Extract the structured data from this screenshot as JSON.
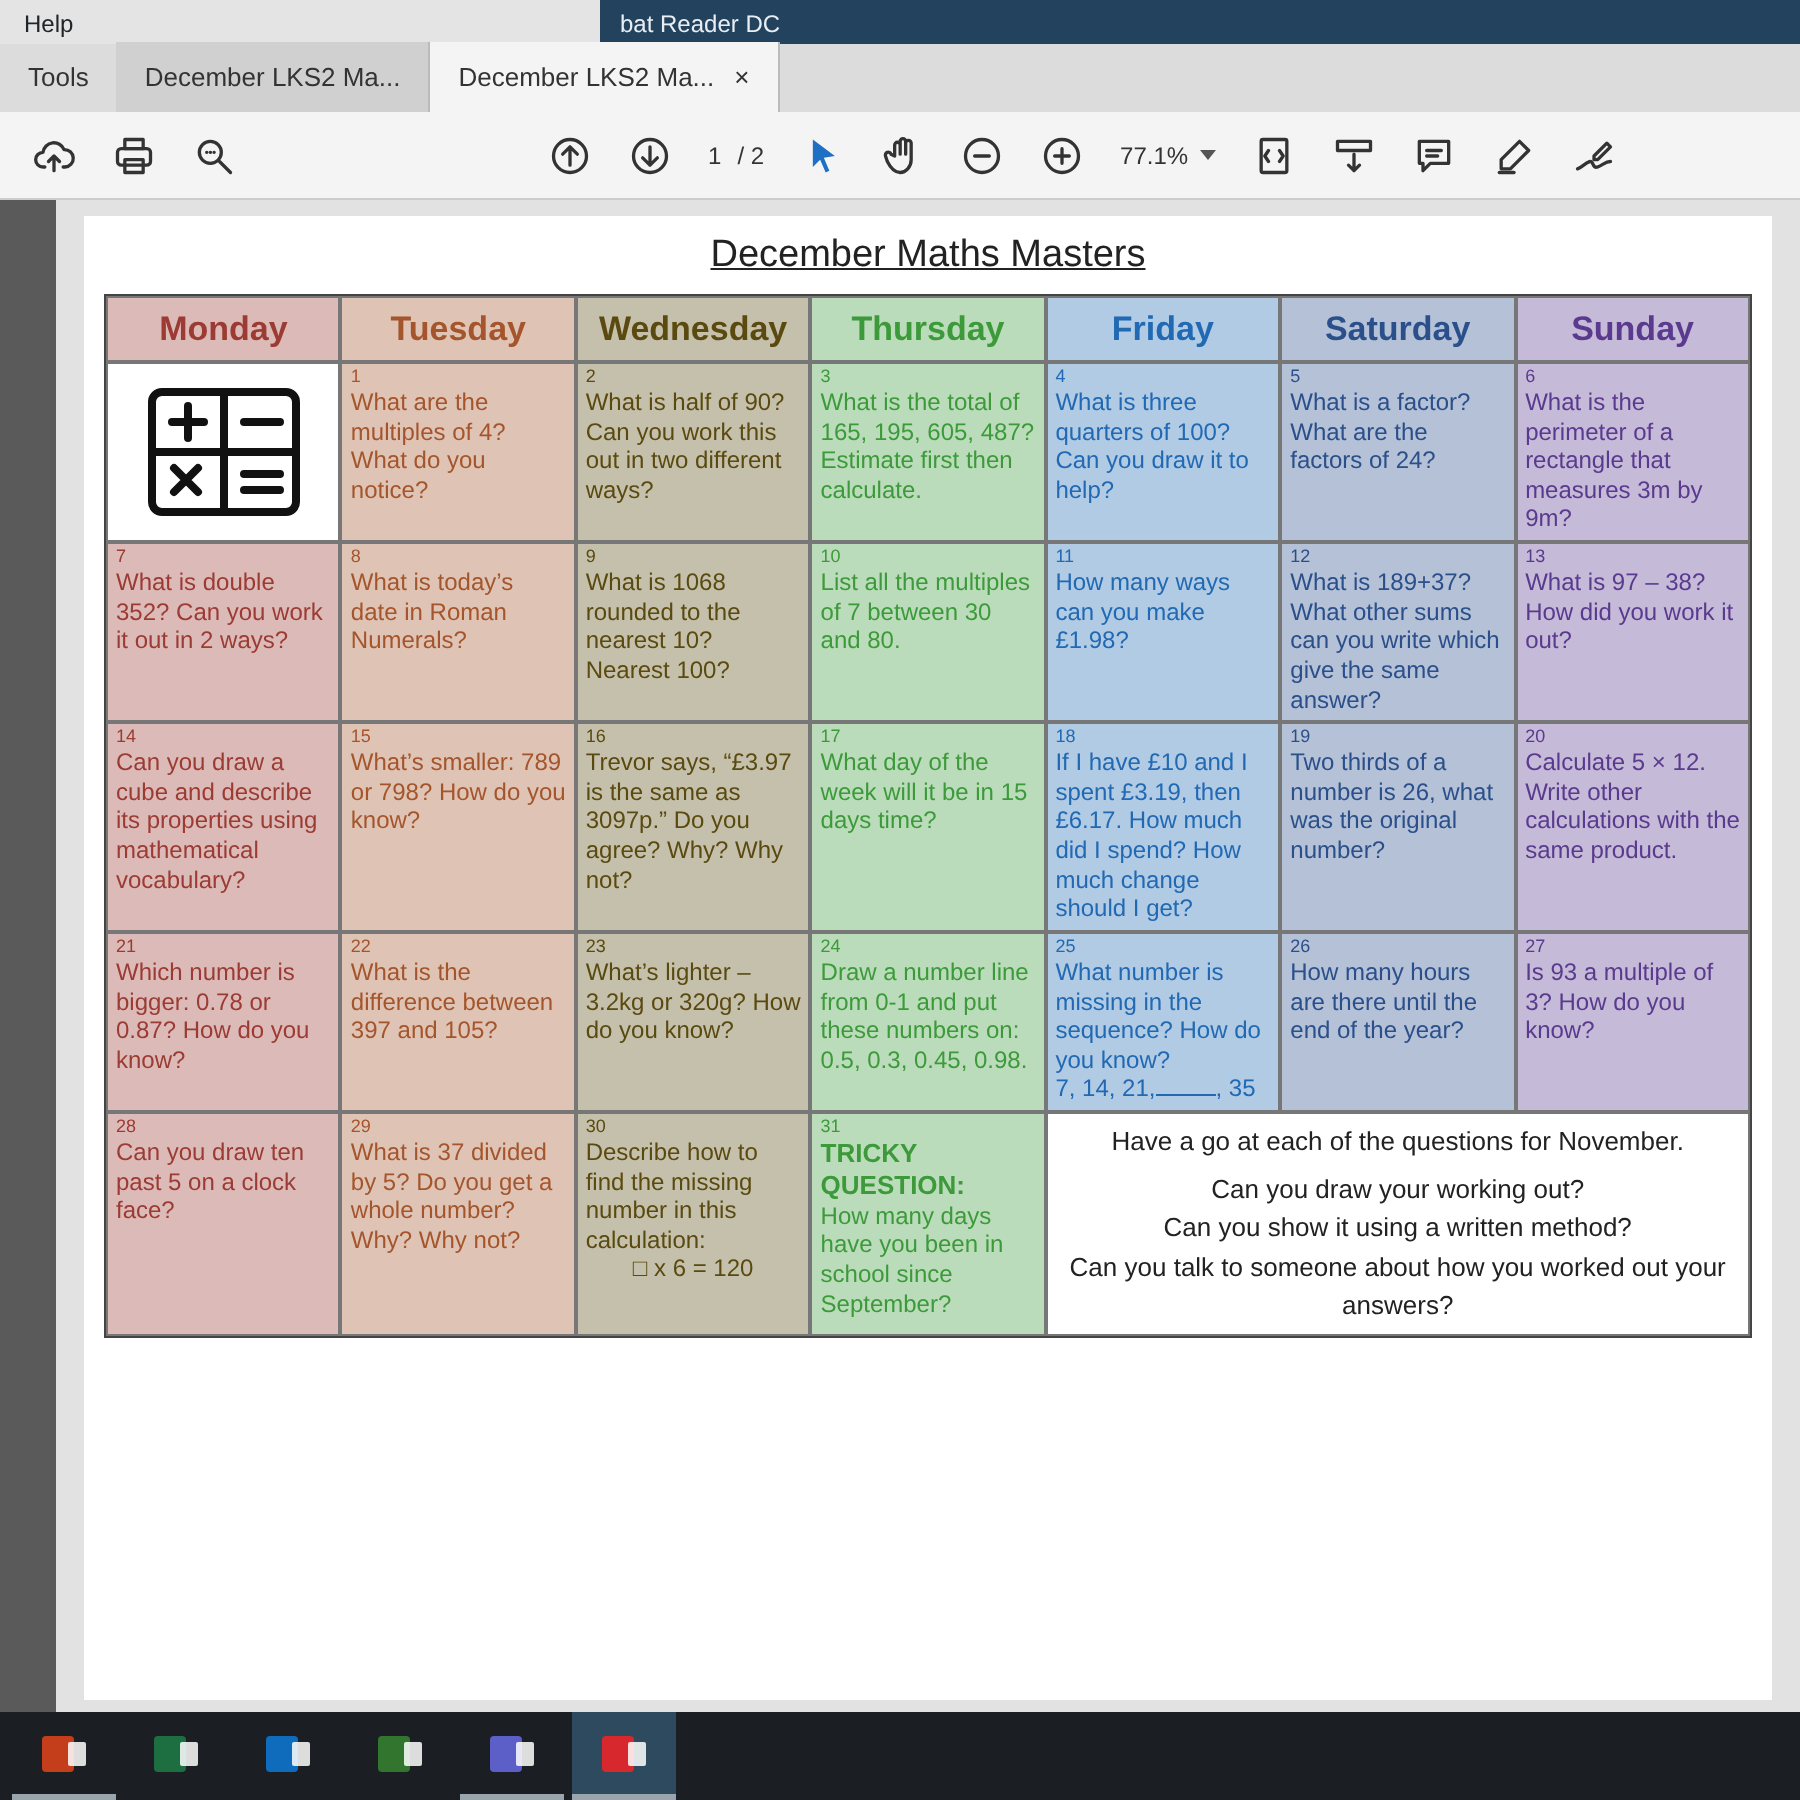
{
  "app": {
    "title": "bat Reader DC",
    "menus": [
      "Help"
    ]
  },
  "home_tab": "Tools",
  "doc_tabs": [
    {
      "label": "December LKS2 Ma...",
      "selected": false
    },
    {
      "label": "December LKS2 Ma...",
      "selected": true,
      "close": "×"
    }
  ],
  "toolbar": {
    "page": "1",
    "page_total": "/ 2",
    "zoom": "77.1%"
  },
  "document": {
    "title": "December Maths Masters",
    "days": [
      {
        "name": "Monday",
        "color": "#9b3b33"
      },
      {
        "name": "Tuesday",
        "color": "#a4552c"
      },
      {
        "name": "Wednesday",
        "color": "#5a4a10"
      },
      {
        "name": "Thursday",
        "color": "#3c9a3a"
      },
      {
        "name": "Friday",
        "color": "#2169b3"
      },
      {
        "name": "Saturday",
        "color": "#2a4f8a"
      },
      {
        "name": "Sunday",
        "color": "#5a3a8e"
      }
    ],
    "weeks": [
      [
        {
          "kind": "logo"
        },
        {
          "kind": "question",
          "number": "1",
          "text": "What are the multiples of 4? What do you notice?"
        },
        {
          "kind": "question",
          "number": "2",
          "text": "What is half of 90? Can you work this out in two different ways?"
        },
        {
          "kind": "question",
          "number": "3",
          "text": "What is the total of 165, 195, 605, 487? Estimate first then calculate."
        },
        {
          "kind": "question",
          "number": "4",
          "text": "What is three quarters of 100? Can you draw it to help?"
        },
        {
          "kind": "question",
          "number": "5",
          "text": "What is a factor? What are the factors of 24?"
        },
        {
          "kind": "question",
          "number": "6",
          "text": "What is the perimeter of a rectangle that measures 3m by 9m?"
        }
      ],
      [
        {
          "kind": "question",
          "number": "7",
          "text": "What is double 352? Can you work it out in 2 ways?"
        },
        {
          "kind": "question",
          "number": "8",
          "text": "What is today’s date in Roman Numerals?"
        },
        {
          "kind": "question",
          "number": "9",
          "text": "What is 1068 rounded to the nearest 10? Nearest 100?"
        },
        {
          "kind": "question",
          "number": "10",
          "text": "List all the multiples of 7 between 30 and 80."
        },
        {
          "kind": "question",
          "number": "11",
          "text": "How many ways can you make £1.98?"
        },
        {
          "kind": "question",
          "number": "12",
          "text": "What is 189+37? What other sums can you write which give the same answer?"
        },
        {
          "kind": "question",
          "number": "13",
          "text": "What is 97 – 38? How did you work it out?"
        }
      ],
      [
        {
          "kind": "question",
          "number": "14",
          "text": "Can you draw a cube and describe its properties using mathematical vocabulary?"
        },
        {
          "kind": "question",
          "number": "15",
          "text": "What’s smaller: 789 or 798? How do you know?"
        },
        {
          "kind": "question",
          "number": "16",
          "text": "Trevor says, “£3.97 is the same as 3097p.” Do you agree? Why? Why not?"
        },
        {
          "kind": "question",
          "number": "17",
          "text": "What day of the week will it be in 15 days time?"
        },
        {
          "kind": "question",
          "number": "18",
          "text": "If I have £10 and I spent £3.19, then £6.17. How much did I spend? How much change should I get?"
        },
        {
          "kind": "question",
          "number": "19",
          "text": "Two thirds of a number is 26, what was the original number?"
        },
        {
          "kind": "question",
          "number": "20",
          "text": "Calculate 5 × 12. Write other calculations with the same product."
        }
      ],
      [
        {
          "kind": "question",
          "number": "21",
          "text": "Which number is bigger: 0.78 or 0.87? How do you know?"
        },
        {
          "kind": "question",
          "number": "22",
          "text": "What is the difference between 397 and 105?"
        },
        {
          "kind": "question",
          "number": "23",
          "text": "What’s lighter – 3.2kg or 320g? How do you know?"
        },
        {
          "kind": "question",
          "number": "24",
          "text": "Draw a number line from 0-1 and put these numbers on: 0.5, 0.3, 0.45, 0.98."
        },
        {
          "kind": "sequence",
          "number": "25",
          "text": "What number is missing in the sequence? How do you know?",
          "before": "7, 14, 21,",
          "after": ", 35"
        },
        {
          "kind": "question",
          "number": "26",
          "text": "How many hours are there until the end of the year?"
        },
        {
          "kind": "question",
          "number": "27",
          "text": "Is 93 a multiple of 3? How do you know?"
        }
      ],
      [
        {
          "kind": "question",
          "number": "28",
          "text": "Can you draw ten past 5 on a clock face?"
        },
        {
          "kind": "question",
          "number": "29",
          "text": "What is 37 divided by 5? Do you get a whole number? Why? Why not?"
        },
        {
          "kind": "equation",
          "number": "30",
          "text": "Describe how to find the missing number in this calculation:",
          "equation": "□ x 6 = 120"
        },
        {
          "kind": "tricky",
          "number": "31",
          "heading": "TRICKY QUESTION:",
          "text": "How many days have you been in school since September?"
        },
        {
          "kind": "note",
          "lines": [
            "Have a go at each of the questions for November.",
            "Can you draw your working out?",
            "Can you show it using a written method?",
            "Can you talk to someone about how you worked out your answers?"
          ]
        }
      ]
    ]
  },
  "taskbar": [
    {
      "color": "#c43e1c",
      "running": true,
      "selected": false
    },
    {
      "color": "#1d6f42",
      "running": false,
      "selected": false
    },
    {
      "color": "#0f6cbd",
      "running": false,
      "selected": false
    },
    {
      "color": "#31752f",
      "running": false,
      "selected": false
    },
    {
      "color": "#5b5fc7",
      "running": true,
      "selected": false
    },
    {
      "color": "#d7282e",
      "running": true,
      "selected": true
    }
  ]
}
